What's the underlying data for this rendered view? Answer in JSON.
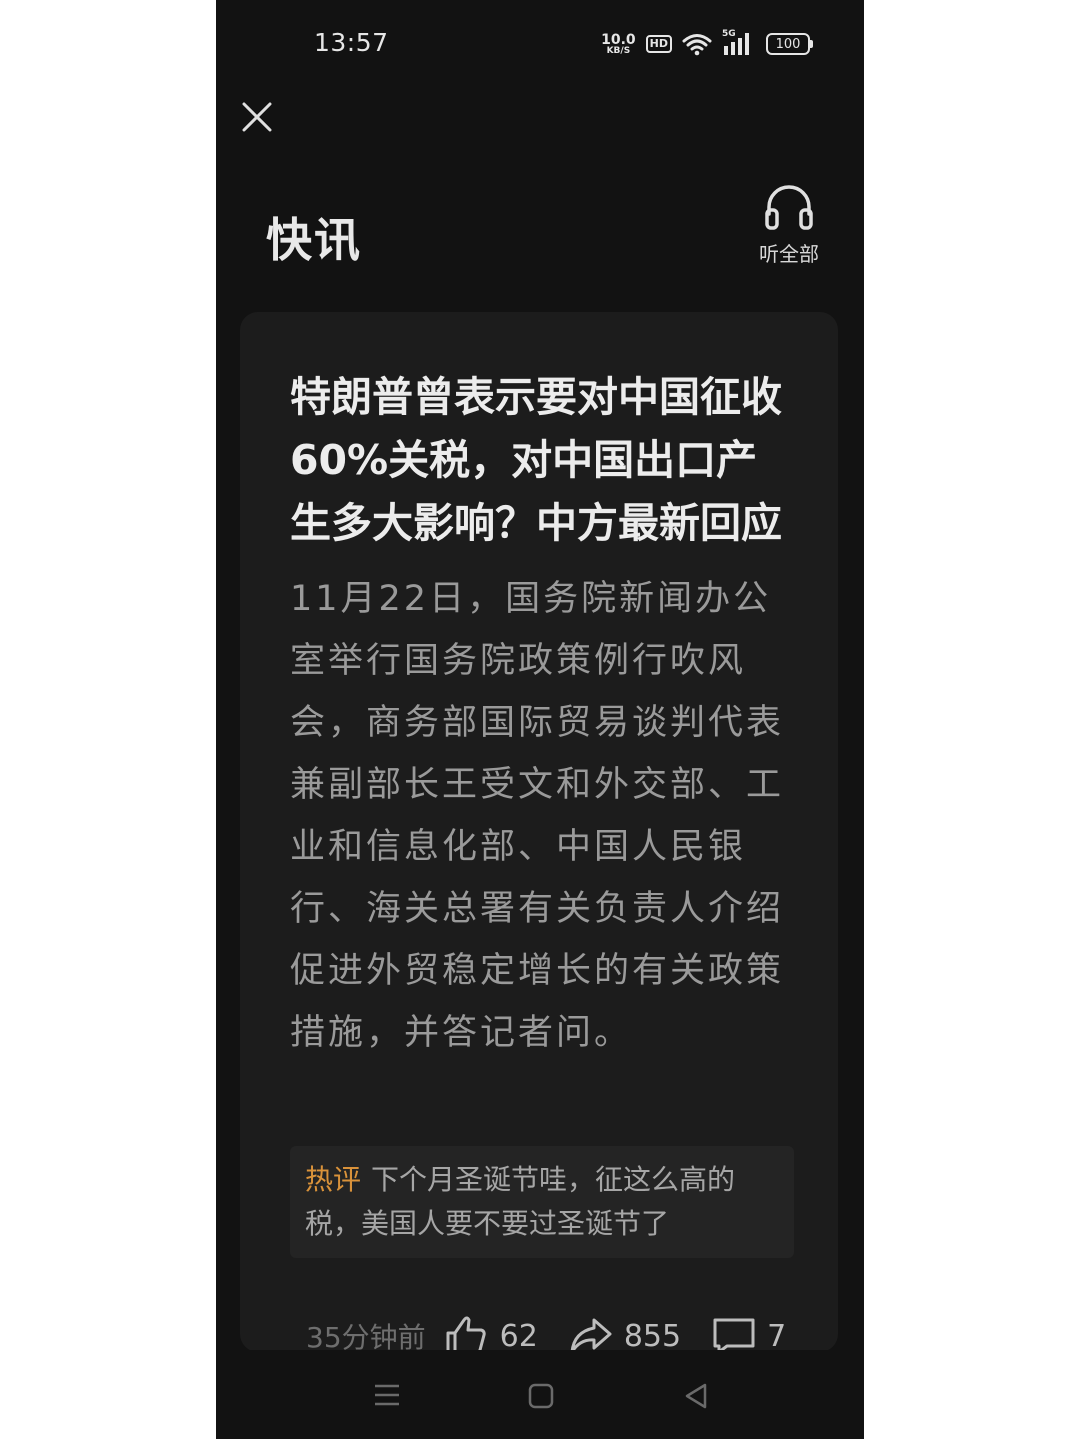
{
  "status_bar": {
    "time": "13:57",
    "net_speed_value": "10.0",
    "net_speed_unit": "KB/S",
    "hd_label": "HD",
    "signal_label": "5G",
    "battery": "100"
  },
  "header": {
    "title": "快讯",
    "listen_all_label": "听全部"
  },
  "article": {
    "headline": "特朗普曾表示要对中国征收60%关税，对中国出口产生多大影响？中方最新回应",
    "summary": "11月22日，国务院新闻办公室举行国务院政策例行吹风会，商务部国际贸易谈判代表兼副部长王受文和外交部、工业和信息化部、中国人民银行、海关总署有关负责人介绍促进外贸稳定增长的有关政策措施，并答记者问。",
    "hot_comment": {
      "tag": "热评",
      "text": "下个月圣诞节哇，征这么高的税，美国人要不要过圣诞节了"
    },
    "meta": {
      "time_ago": "35分钟前",
      "likes": "62",
      "shares": "855",
      "comments": "7"
    }
  },
  "colors": {
    "background": "#121212",
    "card": "#1c1c1c",
    "headline": "#ececec",
    "summary": "#9a9a9a",
    "hot_tag": "#d9923a"
  }
}
